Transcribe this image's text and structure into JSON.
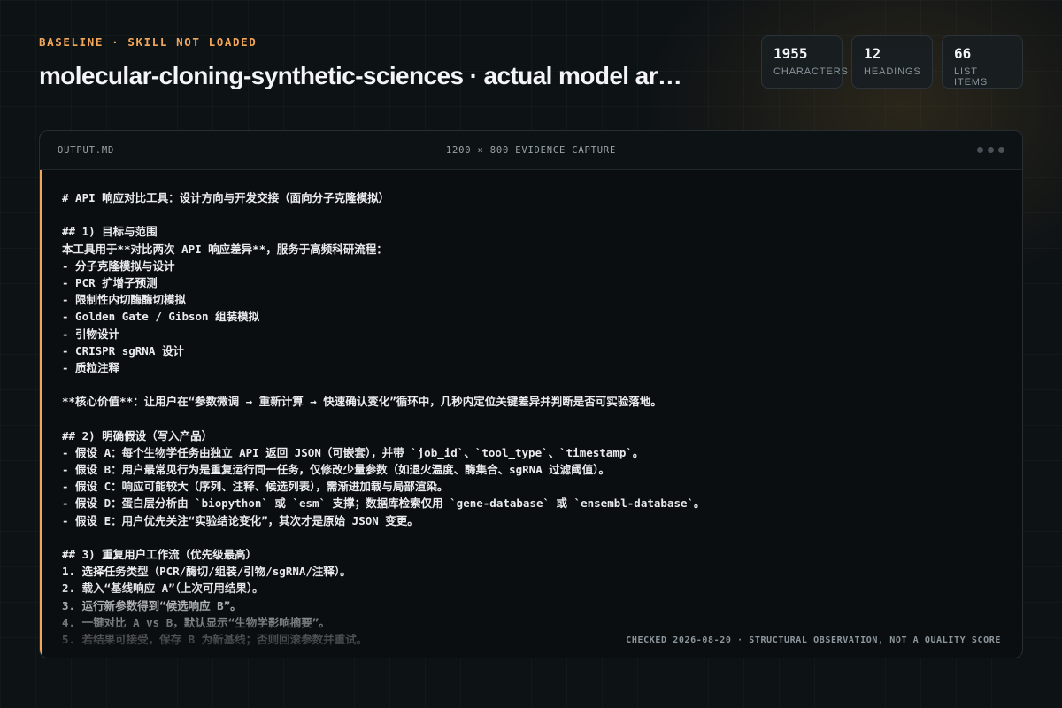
{
  "header": {
    "eyebrow": "BASELINE · SKILL NOT LOADED",
    "title": "molecular-cloning-synthetic-sciences · actual model ar…"
  },
  "stats": [
    {
      "value": "1955",
      "label": "CHARACTERS"
    },
    {
      "value": "12",
      "label": "HEADINGS"
    },
    {
      "value": "66",
      "label": "LIST ITEMS"
    }
  ],
  "panel": {
    "file_name": "OUTPUT.MD",
    "capture_label": "1200 × 800 EVIDENCE CAPTURE",
    "footer": "CHECKED 2026-08-20 · STRUCTURAL OBSERVATION, NOT A QUALITY SCORE",
    "lines": [
      "# API 响应对比工具：设计方向与开发交接（面向分子克隆模拟）",
      "",
      "## 1) 目标与范围",
      "本工具用于**对比两次 API 响应差异**，服务于高频科研流程：",
      "- 分子克隆模拟与设计",
      "- PCR 扩增子预测",
      "- 限制性内切酶酶切模拟",
      "- Golden Gate / Gibson 组装模拟",
      "- 引物设计",
      "- CRISPR sgRNA 设计",
      "- 质粒注释",
      "",
      "**核心价值**：让用户在“参数微调 → 重新计算 → 快速确认变化”循环中，几秒内定位关键差异并判断是否可实验落地。",
      "",
      "## 2) 明确假设（写入产品）",
      "- 假设 A：每个生物学任务由独立 API 返回 JSON（可嵌套），并带 `job_id`、`tool_type`、`timestamp`。",
      "- 假设 B：用户最常见行为是重复运行同一任务，仅修改少量参数（如退火温度、酶集合、sgRNA 过滤阈值）。",
      "- 假设 C：响应可能较大（序列、注释、候选列表），需渐进加载与局部渲染。",
      "- 假设 D：蛋白层分析由 `biopython` 或 `esm` 支撑；数据库检索仅用 `gene-database` 或 `ensembl-database`。",
      "- 假设 E：用户优先关注“实验结论变化”，其次才是原始 JSON 变更。",
      "",
      "## 3) 重复用户工作流（优先级最高）",
      "1. 选择任务类型（PCR/酶切/组装/引物/sgRNA/注释）。",
      "2. 载入“基线响应 A”（上次可用结果）。",
      "3. 运行新参数得到“候选响应 B”。",
      "4. 一键对比 A vs B，默认显示“生物学影响摘要”。",
      "5. 若结果可接受，保存 B 为新基线；否则回滚参数并重试。"
    ]
  }
}
